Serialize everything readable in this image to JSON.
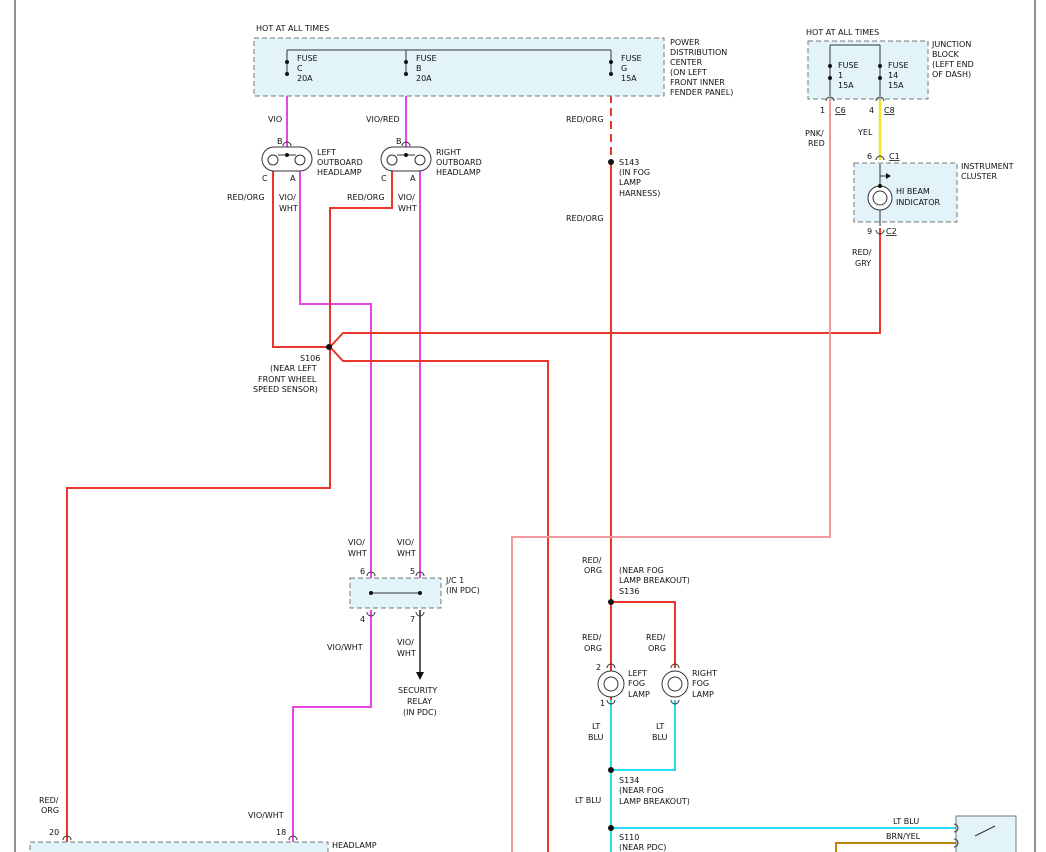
{
  "pdc": {
    "hot": "HOT AT ALL TIMES",
    "fuses": [
      {
        "word": "FUSE",
        "id": "C",
        "amp": "20A"
      },
      {
        "word": "FUSE",
        "id": "B",
        "amp": "20A"
      },
      {
        "word": "FUSE",
        "id": "G",
        "amp": "15A"
      }
    ],
    "label": [
      "POWER",
      "DISTRIBUTION",
      "CENTER",
      "(ON LEFT",
      "FRONT INNER",
      "FENDER PANEL)"
    ]
  },
  "jb": {
    "hot": "HOT AT ALL TIMES",
    "fuses": [
      {
        "word": "FUSE",
        "id": "1",
        "amp": "15A"
      },
      {
        "word": "FUSE",
        "id": "14",
        "amp": "15A"
      }
    ],
    "label": [
      "JUNCTION",
      "BLOCK",
      "(LEFT END",
      "OF DASH)"
    ],
    "pin1": "1",
    "conn1": "C6",
    "pin2": "4",
    "conn2": "C8"
  },
  "cluster": {
    "label": [
      "INSTRUMENT",
      "CLUSTER"
    ],
    "indicator": [
      "HI BEAM",
      "INDICATOR"
    ],
    "pin_top": "6",
    "conn_top": "C1",
    "pin_bot": "9",
    "conn_bot": "C2"
  },
  "left_headlamp": {
    "label": [
      "LEFT",
      "OUTBOARD",
      "HEADLAMP"
    ],
    "pin_b": "B",
    "pin_c": "C",
    "pin_a": "A"
  },
  "right_headlamp": {
    "label": [
      "RIGHT",
      "OUTBOARD",
      "HEADLAMP"
    ],
    "pin_b": "B",
    "pin_c": "C",
    "pin_a": "A"
  },
  "wires": {
    "vio": "VIO",
    "vio_red": "VIO/RED",
    "red_org_g": "RED/ORG",
    "red_org_s143": "RED/ORG",
    "pnk_red": [
      "PNK/",
      "RED"
    ],
    "yel": "YEL",
    "red_gry": [
      "RED/",
      "GRY"
    ],
    "lh_c": "RED/ORG",
    "lh_a": [
      "VIO/",
      "WHT"
    ],
    "rh_c": "RED/ORG",
    "rh_a": [
      "VIO/",
      "WHT"
    ],
    "jc_6": [
      "VIO/",
      "WHT"
    ],
    "jc_5": [
      "VIO/",
      "WHT"
    ],
    "jc_4": "VIO/WHT",
    "jc_7": [
      "VIO/",
      "WHT"
    ],
    "red_org_136": [
      "RED/",
      "ORG"
    ],
    "lfog_red": [
      "RED/",
      "ORG"
    ],
    "rfog_red": [
      "RED/",
      "ORG"
    ],
    "lfog_blu": [
      "LT",
      "BLU"
    ],
    "rfog_blu": [
      "LT",
      "BLU"
    ],
    "lt_blu": "LT BLU",
    "lt_blu_right": "LT BLU",
    "brn_yel": "BRN/YEL",
    "red_org_20": [
      "RED/",
      "ORG"
    ],
    "vio_wht_18": "VIO/WHT"
  },
  "splices": {
    "s143": [
      "S143",
      "(IN FOG",
      "LAMP",
      "HARNESS)"
    ],
    "s106": [
      "S106",
      "(NEAR LEFT",
      "FRONT WHEEL",
      "SPEED SENSOR)"
    ],
    "s136": [
      "(NEAR FOG",
      "LAMP BREAKOUT)",
      "S136"
    ],
    "s134": [
      "S134",
      "(NEAR FOG",
      "LAMP BREAKOUT)"
    ],
    "s110": [
      "S110",
      "(NEAR PDC)"
    ]
  },
  "jc1": {
    "label": [
      "J/C 1",
      "(IN PDC)"
    ],
    "pins": [
      "6",
      "5",
      "4",
      "7"
    ]
  },
  "security": [
    "SECURITY",
    "RELAY",
    "(IN PDC)"
  ],
  "fog": {
    "left": [
      "LEFT",
      "FOG",
      "LAMP"
    ],
    "right": [
      "RIGHT",
      "FOG",
      "LAMP"
    ],
    "pin_top": "2",
    "pin_bot": "1"
  },
  "headlamp_bottom": {
    "label": "HEADLAMP",
    "pin20": "20",
    "pin18": "18"
  },
  "colors": {
    "red": "#e8362a",
    "violet": "#e646e6",
    "pink": "#f09aa0",
    "yellow": "#f5e02a",
    "cyan": "#2adcf0",
    "brown": "#b8860b"
  }
}
